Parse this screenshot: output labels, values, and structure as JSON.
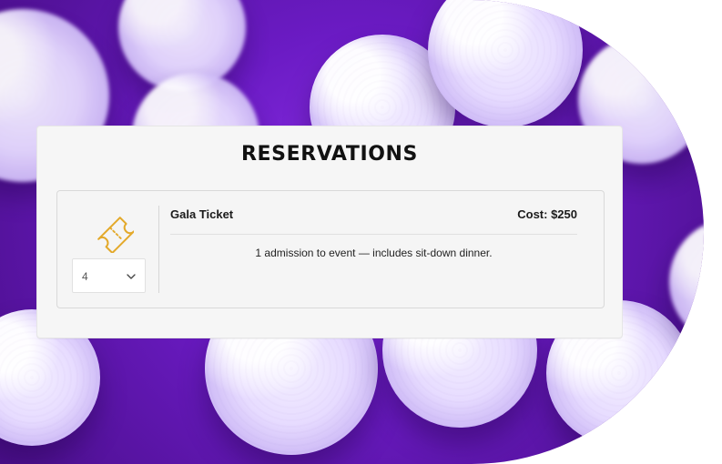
{
  "reservations": {
    "title": "RESERVATIONS",
    "item": {
      "name": "Gala Ticket",
      "cost_label": "Cost: $250",
      "description": "1 admission to event — includes sit-down dinner.",
      "quantity": {
        "selected": "4"
      },
      "icon": "ticket-icon"
    }
  },
  "colors": {
    "background_purple": "#6b1bc4",
    "card": "#f6f6f6",
    "ticket_icon": "#e3a92a"
  }
}
